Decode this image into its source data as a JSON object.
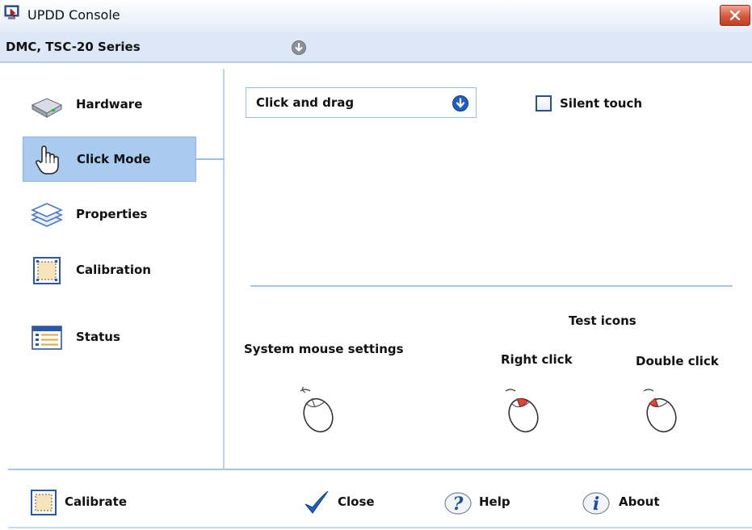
{
  "window": {
    "title": "UPDD Console"
  },
  "device": {
    "name": "DMC, TSC-20 Series"
  },
  "sidebar": {
    "items": [
      {
        "label": "Hardware",
        "icon": "hardware-drive-icon",
        "selected": false
      },
      {
        "label": "Click Mode",
        "icon": "hand-pointer-icon",
        "selected": true
      },
      {
        "label": "Properties",
        "icon": "layers-icon",
        "selected": false
      },
      {
        "label": "Calibration",
        "icon": "calibration-icon",
        "selected": false
      },
      {
        "label": "Status",
        "icon": "status-list-icon",
        "selected": false
      }
    ]
  },
  "click_mode": {
    "selected_mode": "Click and drag",
    "silent_touch_label": "Silent touch",
    "silent_touch_checked": false
  },
  "test_icons": {
    "title": "Test icons",
    "system_mouse_label": "System mouse settings",
    "right_click_label": "Right click",
    "double_click_label": "Double click"
  },
  "footer": {
    "calibrate_label": "Calibrate",
    "close_label": "Close",
    "help_label": "Help",
    "about_label": "About"
  },
  "colors": {
    "selected_bg": "#a8cbef",
    "accent_blue": "#1f5fc4",
    "divider": "#a9c6ea",
    "close_red": "#c43f24"
  }
}
